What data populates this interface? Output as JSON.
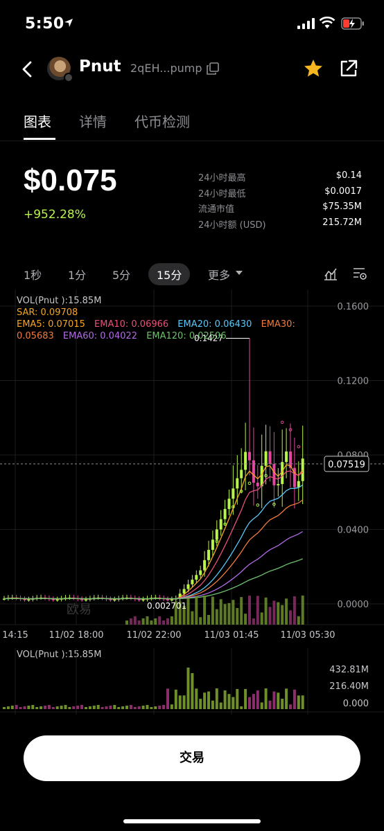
{
  "status_bar": {
    "time": "5:50"
  },
  "nav": {
    "title": "Pnut",
    "address": "2qEH...pump"
  },
  "tabs": [
    {
      "label": "图表",
      "active": true
    },
    {
      "label": "详情",
      "active": false
    },
    {
      "label": "代币检测",
      "active": false
    }
  ],
  "price": {
    "value": "$0.075",
    "change": "+952.28%"
  },
  "stats": [
    {
      "label": "24小时最高",
      "value": "$0.14"
    },
    {
      "label": "24小时最低",
      "value": "$0.0017"
    },
    {
      "label": "流通市值",
      "value": "$75.35M"
    },
    {
      "label": "24小时额 (USD)",
      "value": "215.72M"
    }
  ],
  "intervals": [
    {
      "label": "1秒",
      "selected": false
    },
    {
      "label": "1分",
      "selected": false
    },
    {
      "label": "5分",
      "selected": false
    },
    {
      "label": "15分",
      "selected": true
    },
    {
      "label": "更多",
      "selected": false
    }
  ],
  "indicators": {
    "vol": "VOL(Pnut ):15.85M",
    "sar": "SAR: 0.09708",
    "ema5": "EMA5: 0.07015",
    "ema10": "EMA10: 0.06966",
    "ema20": "EMA20: 0.06430",
    "ema30": "EMA30:",
    "ema30_value": "0.05683",
    "ema60": "EMA60: 0.04022",
    "ema120": "EMA120: 0.02506"
  },
  "colors": {
    "up": "#b8f54a",
    "down": "#e0479e",
    "sar": "#f5a623",
    "ema5": "#f5a623",
    "ema10": "#e8507a",
    "ema20": "#5ac8fa",
    "ema30": "#f07c3c",
    "ema60": "#b36be8",
    "ema120": "#6cc36c"
  },
  "chart_data": {
    "type": "candlestick",
    "y_ticks": [
      "0.1600",
      "0.1200",
      "0.0800",
      "0.0400",
      "0.0000"
    ],
    "x_ticks": [
      "14:15",
      "11/02 18:00",
      "11/02 22:00",
      "11/03 01:45",
      "11/03 05:30"
    ],
    "ylim": [
      0,
      0.16
    ],
    "max_label": "0.1427",
    "min_label": "0.002701",
    "current_price_label": "0.07519",
    "watermark": "欧易",
    "vol_ticks": [
      "432.81M",
      "216.40M",
      "0.000"
    ],
    "vol_label": "VOL(Pnut ):15.85M"
  },
  "trade_button": "交易"
}
